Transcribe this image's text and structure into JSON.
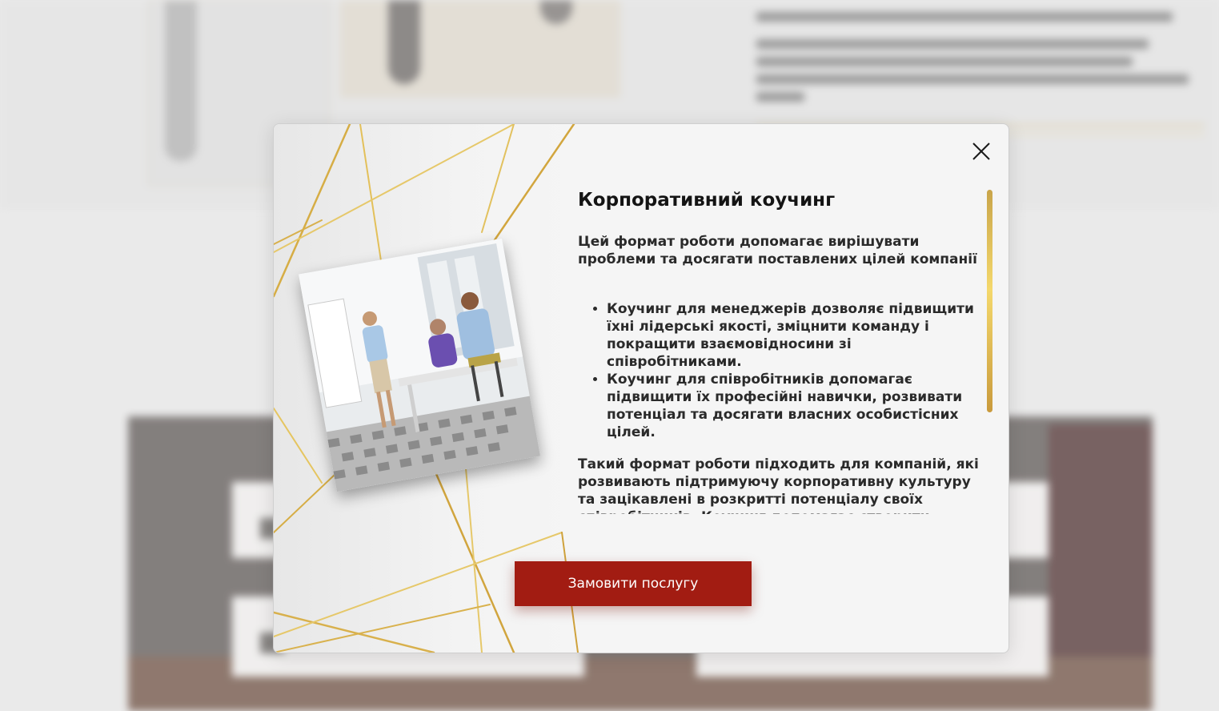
{
  "modal": {
    "title": "Корпоративний коучинг",
    "lead": "Цей формат роботи допомагає вирішувати проблеми та досягати поставлених цілей компанії",
    "bullets": [
      "Коучинг для менеджерів дозволяє підвищити їхні лідерські якості, зміцнити команду і покращити взаємовідносини зі співробітниками.",
      "Коучинг для співробітників допомагає підвищити їх професійні навички, розвивати потенціал та досягати власних особистісних цілей."
    ],
    "outro": "Такий формат роботи підходить для компаній, які розвивають підтримуючу корпоративну культуру та зацікавлені в розкритті потенціалу своїх співробітників. Коучинг допомагає створити",
    "cta_label": "Замовити послугу",
    "close_icon": "close-icon",
    "photo_icon": "team-meeting-photo"
  },
  "colors": {
    "cta": "#a21c12",
    "gold": "#d4a93c",
    "modal_bg": "#f5f5f5"
  }
}
